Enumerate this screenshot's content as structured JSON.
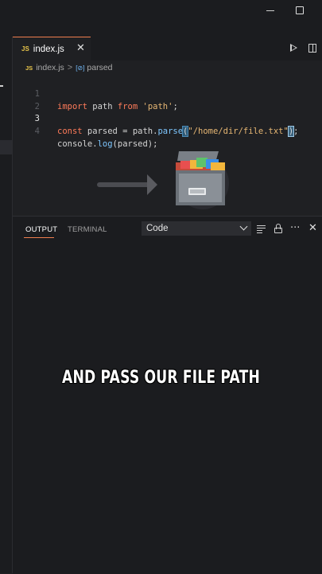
{
  "window": {
    "minimize_icon": "minimize-icon",
    "maximize_icon": "maximize-icon"
  },
  "tab": {
    "badge": "JS",
    "label": "index.js",
    "close": "✕"
  },
  "breadcrumb": {
    "badge": "JS",
    "file": "index.js",
    "separator": ">",
    "symbol_icon": "[⊘]",
    "symbol": "parsed"
  },
  "editor": {
    "current_line": 3,
    "lines": [
      {
        "number": "1",
        "text": "import path from 'path';"
      },
      {
        "number": "2",
        "text": ""
      },
      {
        "number": "3",
        "text": "const parsed = path.parse(\"/home/dir/file.txt\");"
      },
      {
        "number": "4",
        "text": "console.log(parsed);"
      }
    ]
  },
  "panel": {
    "tabs": [
      {
        "label": "OUTPUT",
        "active": true
      },
      {
        "label": "TERMINAL",
        "active": false
      }
    ],
    "channel_select": "Code",
    "more": "···",
    "close": "✕"
  },
  "caption": "AND PASS OUR FILE PATH",
  "colors": {
    "accent": "#f07e4e",
    "keyword": "#ff7b5a",
    "string": "#e6b673",
    "function": "#7ec7ff",
    "background": "#1f2023"
  }
}
